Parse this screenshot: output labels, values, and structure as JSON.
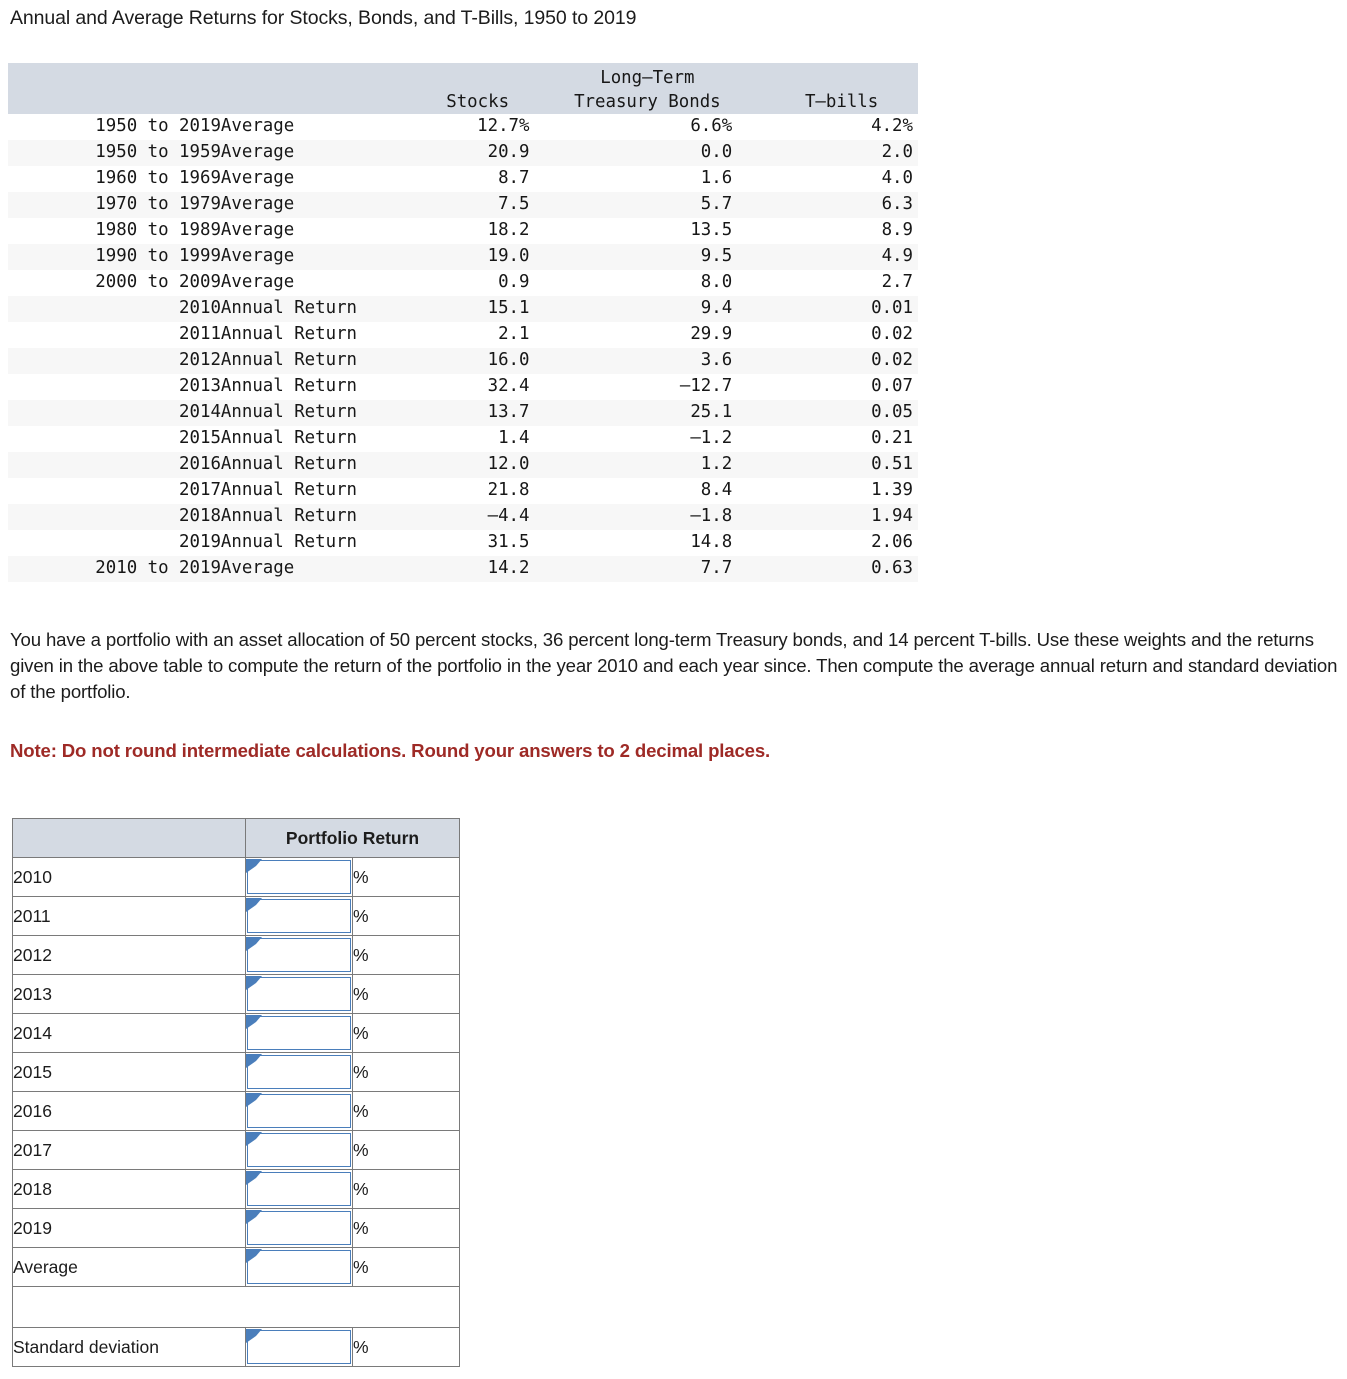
{
  "page_title": "Annual and Average Returns for Stocks, Bonds, and T-Bills, 1950 to 2019",
  "returns_table": {
    "headers": {
      "period": "",
      "type": "",
      "stocks": "Stocks",
      "bonds_line1": "Long–Term",
      "bonds_line2": "Treasury Bonds",
      "tbills": "T–bills"
    },
    "rows": [
      {
        "period": "1950 to 2019",
        "type": "Average",
        "stocks": "12.7%",
        "bonds": "6.6%",
        "tbills": "4.2%"
      },
      {
        "period": "1950 to 1959",
        "type": "Average",
        "stocks": "20.9",
        "bonds": "0.0",
        "tbills": "2.0"
      },
      {
        "period": "1960 to 1969",
        "type": "Average",
        "stocks": "8.7",
        "bonds": "1.6",
        "tbills": "4.0"
      },
      {
        "period": "1970 to 1979",
        "type": "Average",
        "stocks": "7.5",
        "bonds": "5.7",
        "tbills": "6.3"
      },
      {
        "period": "1980 to 1989",
        "type": "Average",
        "stocks": "18.2",
        "bonds": "13.5",
        "tbills": "8.9"
      },
      {
        "period": "1990 to 1999",
        "type": "Average",
        "stocks": "19.0",
        "bonds": "9.5",
        "tbills": "4.9"
      },
      {
        "period": "2000 to 2009",
        "type": "Average",
        "stocks": "0.9",
        "bonds": "8.0",
        "tbills": "2.7"
      },
      {
        "period": "2010",
        "type": "Annual Return",
        "stocks": "15.1",
        "bonds": "9.4",
        "tbills": "0.01"
      },
      {
        "period": "2011",
        "type": "Annual Return",
        "stocks": "2.1",
        "bonds": "29.9",
        "tbills": "0.02"
      },
      {
        "period": "2012",
        "type": "Annual Return",
        "stocks": "16.0",
        "bonds": "3.6",
        "tbills": "0.02"
      },
      {
        "period": "2013",
        "type": "Annual Return",
        "stocks": "32.4",
        "bonds": "–12.7",
        "tbills": "0.07"
      },
      {
        "period": "2014",
        "type": "Annual Return",
        "stocks": "13.7",
        "bonds": "25.1",
        "tbills": "0.05"
      },
      {
        "period": "2015",
        "type": "Annual Return",
        "stocks": "1.4",
        "bonds": "–1.2",
        "tbills": "0.21"
      },
      {
        "period": "2016",
        "type": "Annual Return",
        "stocks": "12.0",
        "bonds": "1.2",
        "tbills": "0.51"
      },
      {
        "period": "2017",
        "type": "Annual Return",
        "stocks": "21.8",
        "bonds": "8.4",
        "tbills": "1.39"
      },
      {
        "period": "2018",
        "type": "Annual Return",
        "stocks": "–4.4",
        "bonds": "–1.8",
        "tbills": "1.94"
      },
      {
        "period": "2019",
        "type": "Annual Return",
        "stocks": "31.5",
        "bonds": "14.8",
        "tbills": "2.06"
      },
      {
        "period": "2010 to 2019",
        "type": "Average",
        "stocks": "14.2",
        "bonds": "7.7",
        "tbills": "0.63"
      }
    ]
  },
  "question": {
    "body": "You have a portfolio with an asset allocation of 50 percent stocks, 36 percent long-term Treasury bonds, and 14 percent T-bills. Use these weights and the returns given in the above table to compute the return of the portfolio in the year 2010 and each year since. Then compute the average annual return and standard deviation of the portfolio.",
    "note": "Note: Do not round intermediate calculations. Round your answers to 2 decimal places."
  },
  "answer_table": {
    "header_blank": "",
    "header_portfolio_return": "Portfolio Return",
    "percent_symbol": "%",
    "rows": [
      {
        "label": "2010",
        "value": ""
      },
      {
        "label": "2011",
        "value": ""
      },
      {
        "label": "2012",
        "value": ""
      },
      {
        "label": "2013",
        "value": ""
      },
      {
        "label": "2014",
        "value": ""
      },
      {
        "label": "2015",
        "value": ""
      },
      {
        "label": "2016",
        "value": ""
      },
      {
        "label": "2017",
        "value": ""
      },
      {
        "label": "2018",
        "value": ""
      },
      {
        "label": "2019",
        "value": ""
      },
      {
        "label": "Average",
        "value": ""
      }
    ],
    "spacer_label": "",
    "std_row": {
      "label": "Standard deviation",
      "value": ""
    }
  },
  "colors": {
    "header_band": "#d4dae3",
    "row_stripe": "#f7f7f7",
    "note_red": "#9e2a26",
    "input_border_blue": "#4a7ebb",
    "table_border": "#7a7a7a"
  }
}
